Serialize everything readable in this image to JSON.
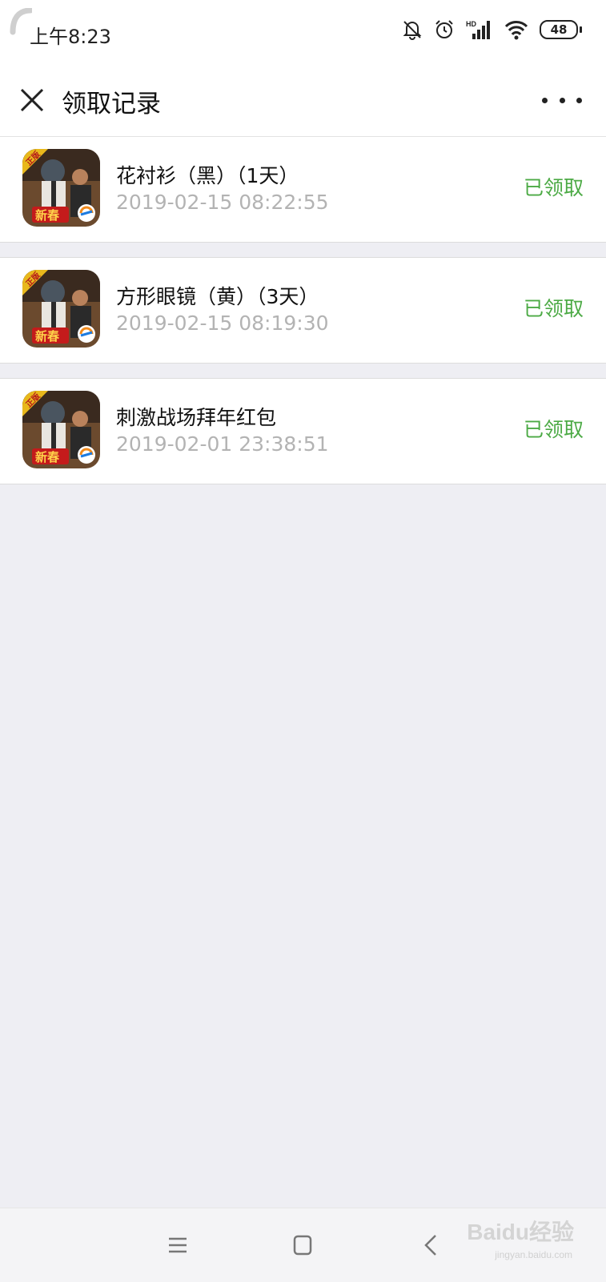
{
  "status_bar": {
    "time": "上午8:23",
    "battery": "48",
    "icons": [
      "mute-bell-icon",
      "alarm-icon",
      "hd-signal-icon",
      "wifi-icon",
      "battery-icon"
    ]
  },
  "nav": {
    "title": "领取记录",
    "close_icon": "close-icon",
    "more_icon": "more-icon"
  },
  "records": [
    {
      "name": "花衬衫（黑）（1天）",
      "time": "2019-02-15 08:22:55",
      "status": "已领取"
    },
    {
      "name": "方形眼镜（黄）（3天）",
      "time": "2019-02-15 08:19:30",
      "status": "已领取"
    },
    {
      "name": "刺激战场拜年红包",
      "time": "2019-02-01 23:38:51",
      "status": "已领取"
    }
  ],
  "game_icon_text": {
    "top_badge": "正版",
    "bottom_badge": "新春"
  },
  "bottom_nav": {
    "icons": [
      "menu-icon",
      "home-square-icon",
      "back-icon"
    ]
  },
  "watermark": {
    "text": "Baidu经验",
    "sub": "jingyan.baidu.com"
  },
  "colors": {
    "status_green": "#4caa45",
    "time_gray": "#b3b3b3",
    "page_bg": "#eeeef3"
  }
}
